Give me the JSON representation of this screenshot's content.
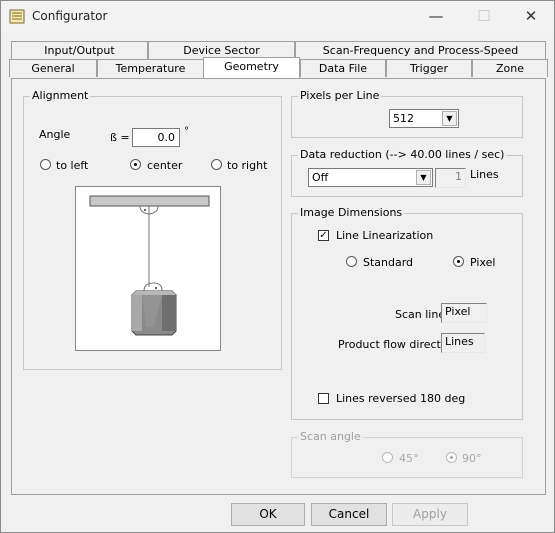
{
  "window": {
    "title": "Configurator",
    "app_icon": "notepad-icon",
    "minimize_glyph": "—",
    "maximize_glyph": "☐",
    "close_glyph": "✕"
  },
  "tabs": {
    "back_row": [
      "Input/Output",
      "Device Sector",
      "Scan-Frequency and Process-Speed"
    ],
    "front_row": [
      "General",
      "Temperature",
      "Geometry",
      "Data File",
      "Trigger",
      "Zone"
    ],
    "active": "Geometry"
  },
  "alignment": {
    "legend": "Alignment",
    "angle_label": "Angle",
    "beta_label": "ß =",
    "angle_value": "0.0",
    "degree_symbol": "°",
    "options": [
      "to left",
      "center",
      "to right"
    ],
    "selected": "center"
  },
  "pixels_per_line": {
    "legend": "Pixels per Line",
    "value": "512"
  },
  "data_reduction": {
    "legend": "Data reduction (--> 40.00 lines / sec)",
    "value": "Off",
    "lines_value": "1",
    "lines_label": "Lines"
  },
  "image_dimensions": {
    "legend": "Image Dimensions",
    "line_linearization_label": "Line Linearization",
    "line_linearization_checked": true,
    "standard_label": "Standard",
    "pixel_label": "Pixel",
    "selected": "Pixel",
    "scan_line_label": "Scan line",
    "scan_line_value": "Pixel",
    "product_flow_label": "Product flow direction",
    "product_flow_value": "Lines",
    "lines_reversed_label": "Lines reversed 180 deg",
    "lines_reversed_checked": false
  },
  "scan_angle": {
    "legend": "Scan angle",
    "option_45": "45°",
    "option_90": "90°",
    "selected": "90°",
    "enabled": false
  },
  "buttons": {
    "ok": "OK",
    "cancel": "Cancel",
    "apply": "Apply"
  },
  "colors": {
    "background": "#f0f0f0",
    "device_body": "#8a8a8a",
    "beam": "#c8c8c8"
  }
}
